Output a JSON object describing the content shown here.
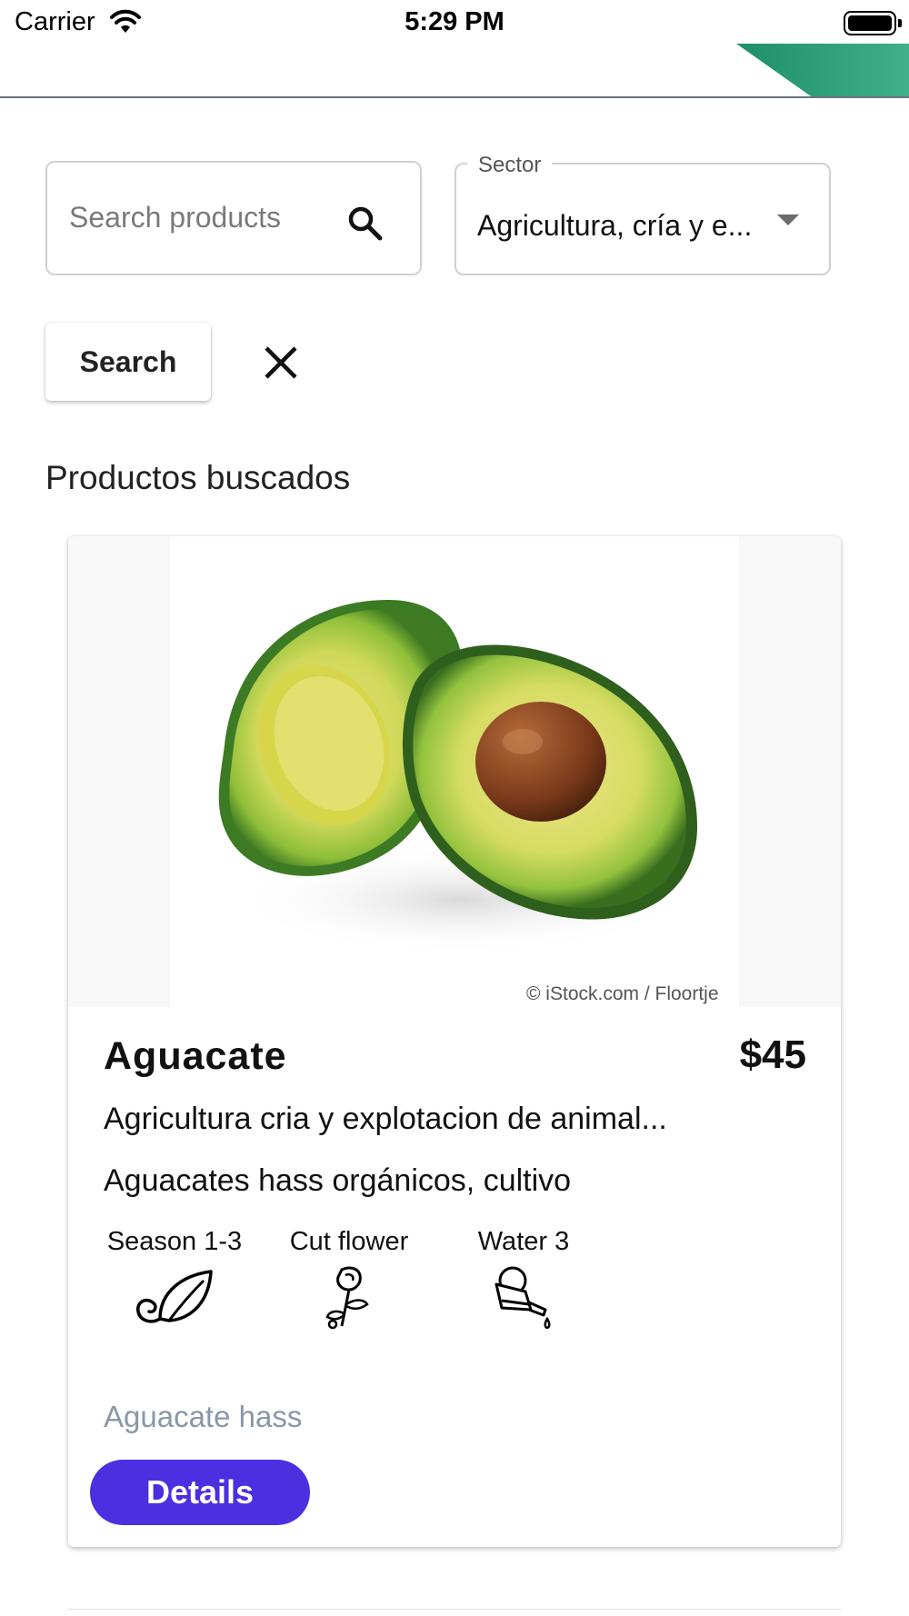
{
  "status_bar": {
    "carrier": "Carrier",
    "time": "5:29 PM"
  },
  "appbar": {
    "accent_colors": [
      "#2aa37e",
      "#1f8f6a"
    ],
    "divider_color": "#6b7280"
  },
  "search": {
    "placeholder": "Search products",
    "value": ""
  },
  "sector": {
    "label": "Sector",
    "value": "Agricultura, cría y e..."
  },
  "actions": {
    "search_label": "Search"
  },
  "section_title": "Productos buscados",
  "product": {
    "image_credit": "© iStock.com / Floortje",
    "name": "Aguacate",
    "price": "$45",
    "sector": "Agricultura cria y explotacion de animal...",
    "description": "Aguacates hass orgánicos, cultivo",
    "attributes": [
      {
        "label": "Season 1-3",
        "icon": "leaf-icon"
      },
      {
        "label": "Cut flower",
        "icon": "rose-icon"
      },
      {
        "label": "Water 3",
        "icon": "watering-can-icon"
      }
    ],
    "variety": "Aguacate hass",
    "details_label": "Details",
    "button_color": "#4b2fe0"
  }
}
